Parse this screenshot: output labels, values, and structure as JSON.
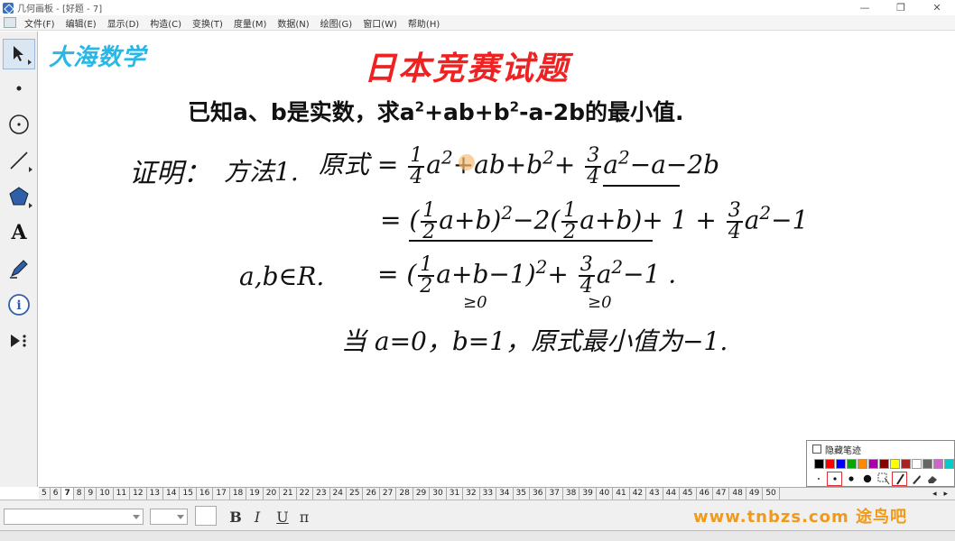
{
  "window": {
    "title": "几何画板 - [好题 - 7]",
    "controls": [
      "—",
      "❐",
      "✕"
    ]
  },
  "menu": {
    "items": [
      "文件(F)",
      "编辑(E)",
      "显示(D)",
      "构造(C)",
      "变换(T)",
      "度量(M)",
      "数据(N)",
      "绘图(G)",
      "窗口(W)",
      "帮助(H)"
    ]
  },
  "toolbar": {
    "tools": [
      {
        "name": "arrow-tool",
        "glyph": "➤"
      },
      {
        "name": "point-tool",
        "glyph": "•"
      },
      {
        "name": "compass-tool",
        "glyph": "⊕"
      },
      {
        "name": "line-tool",
        "glyph": "╱"
      },
      {
        "name": "polygon-tool",
        "glyph": "⬟"
      },
      {
        "name": "text-tool",
        "glyph": "A"
      },
      {
        "name": "marker-tool",
        "glyph": "✎"
      },
      {
        "name": "info-tool",
        "glyph": "i"
      },
      {
        "name": "custom-tool",
        "glyph": "▶⁝"
      }
    ]
  },
  "canvas": {
    "brand": "大海数学",
    "title": "日本竞赛试题",
    "problem": {
      "part1": "已知a、b是实数，求a",
      "part2": "+ab+b",
      "part3": "-a-2b的最小值."
    },
    "solution": {
      "label": "证明：",
      "method": "方法1.",
      "original": "原式",
      "line1_tail": "−a−2b",
      "line2_tail": "+ 1",
      "line3_cond": "a,b∈R.",
      "line3_tail": "−1",
      "ge0": "≥0",
      "conclusion": "当 a=0，b=1，原式最小值为−1."
    }
  },
  "pen_panel": {
    "label": "隐藏笔迹",
    "colors": [
      "#000000",
      "#ff0000",
      "#0000ff",
      "#00aa00",
      "#ff8800",
      "#aa00aa",
      "#880000",
      "#ffff00",
      "#aa2222",
      "#ffffff",
      "#666666",
      "#cc66cc",
      "#00cccc"
    ]
  },
  "pages": {
    "tabs": [
      "5",
      "6",
      "7",
      "8",
      "9",
      "10",
      "11",
      "12",
      "13",
      "14",
      "15",
      "16",
      "17",
      "18",
      "19",
      "20",
      "21",
      "22",
      "23",
      "24",
      "25",
      "26",
      "27",
      "28",
      "29",
      "30",
      "31",
      "32",
      "33",
      "34",
      "35",
      "36",
      "37",
      "38",
      "39",
      "40",
      "41",
      "42",
      "43",
      "44",
      "45",
      "46",
      "47",
      "48",
      "49",
      "50"
    ],
    "active": "7"
  },
  "format": {
    "bold": "B",
    "italic": "I",
    "underline": "U",
    "symbol": "π"
  },
  "watermark": "www.tnbzs.com 途鸟吧"
}
